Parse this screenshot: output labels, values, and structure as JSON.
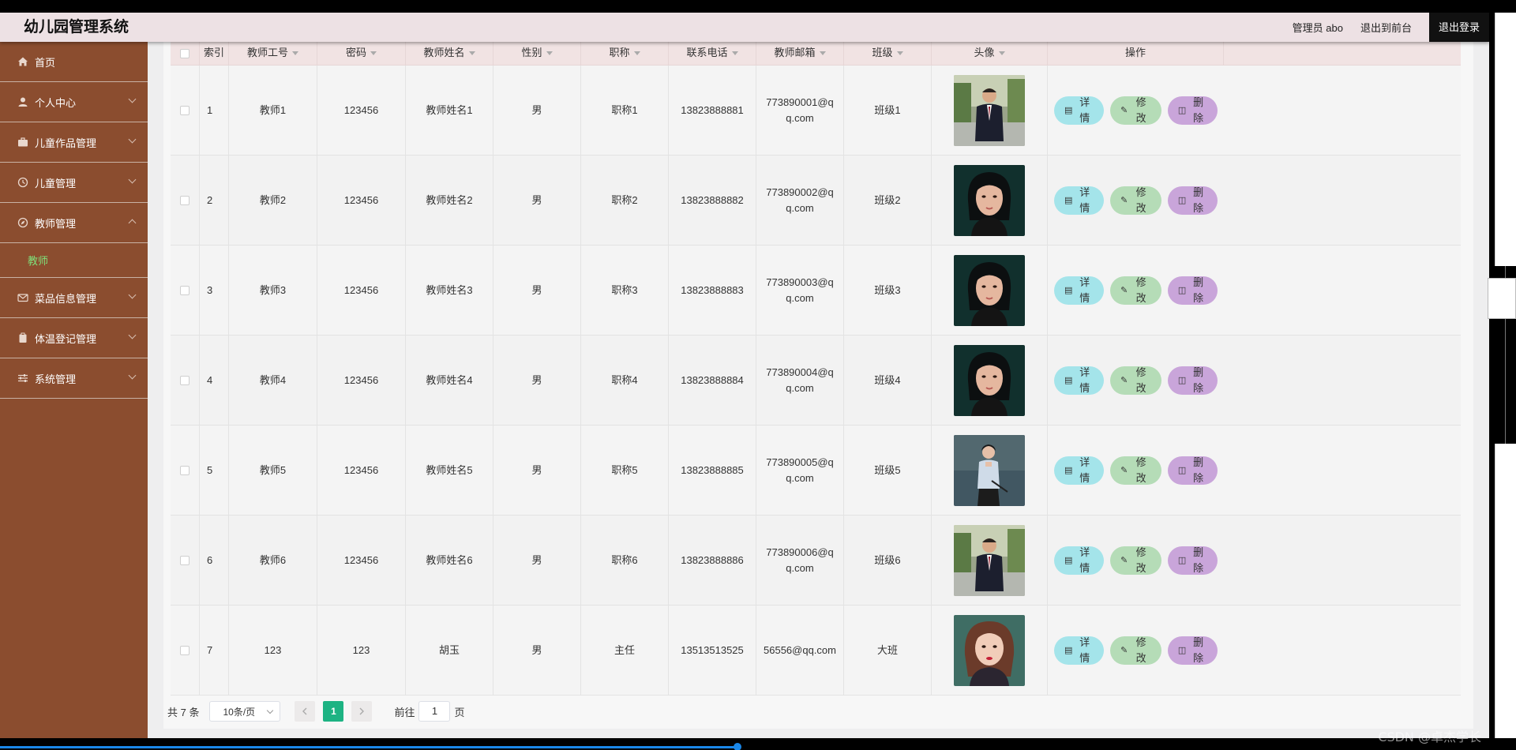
{
  "header": {
    "brand": "幼儿园管理系统",
    "user": "管理员 abo",
    "front_link": "退出到前台",
    "logout": "退出登录"
  },
  "sidebar": {
    "items": [
      {
        "label": "首页",
        "icon": "home-icon",
        "has_children": false
      },
      {
        "label": "个人中心",
        "icon": "user-icon",
        "has_children": true
      },
      {
        "label": "儿童作品管理",
        "icon": "briefcase-icon",
        "has_children": true
      },
      {
        "label": "儿童管理",
        "icon": "clock-icon",
        "has_children": true
      },
      {
        "label": "教师管理",
        "icon": "compass-icon",
        "has_children": true,
        "open": true,
        "children": [
          "教师"
        ]
      },
      {
        "label": "菜品信息管理",
        "icon": "mail-icon",
        "has_children": true
      },
      {
        "label": "体温登记管理",
        "icon": "clipboard-icon",
        "has_children": true
      },
      {
        "label": "系统管理",
        "icon": "sliders-icon",
        "has_children": true
      }
    ]
  },
  "table": {
    "columns": [
      "",
      "索引",
      "教师工号",
      "密码",
      "教师姓名",
      "性别",
      "职称",
      "联系电话",
      "教师邮箱",
      "班级",
      "头像",
      "操作"
    ],
    "rows": [
      {
        "index": "1",
        "id": "教师1",
        "password": "123456",
        "name": "教师姓名1",
        "gender": "男",
        "title": "职称1",
        "phone": "13823888881",
        "email": "773890001@qq.com",
        "class": "班级1",
        "avatar": "man-suit"
      },
      {
        "index": "2",
        "id": "教师2",
        "password": "123456",
        "name": "教师姓名2",
        "gender": "男",
        "title": "职称2",
        "phone": "13823888882",
        "email": "773890002@qq.com",
        "class": "班级2",
        "avatar": "woman-dark"
      },
      {
        "index": "3",
        "id": "教师3",
        "password": "123456",
        "name": "教师姓名3",
        "gender": "男",
        "title": "职称3",
        "phone": "13823888883",
        "email": "773890003@qq.com",
        "class": "班级3",
        "avatar": "woman-dark"
      },
      {
        "index": "4",
        "id": "教师4",
        "password": "123456",
        "name": "教师姓名4",
        "gender": "男",
        "title": "职称4",
        "phone": "13823888884",
        "email": "773890004@qq.com",
        "class": "班级4",
        "avatar": "woman-dark"
      },
      {
        "index": "5",
        "id": "教师5",
        "password": "123456",
        "name": "教师姓名5",
        "gender": "男",
        "title": "职称5",
        "phone": "13823888885",
        "email": "773890005@qq.com",
        "class": "班级5",
        "avatar": "woman-shirt"
      },
      {
        "index": "6",
        "id": "教师6",
        "password": "123456",
        "name": "教师姓名6",
        "gender": "男",
        "title": "职称6",
        "phone": "13823888886",
        "email": "773890006@qq.com",
        "class": "班级6",
        "avatar": "man-suit"
      },
      {
        "index": "7",
        "id": "123",
        "password": "123",
        "name": "胡玉",
        "gender": "男",
        "title": "主任",
        "phone": "13513513525",
        "email": "56556@qq.com",
        "class": "大班",
        "avatar": "woman-red"
      }
    ],
    "ops": {
      "detail": "详情",
      "edit": "修改",
      "delete": "删除"
    }
  },
  "pager": {
    "total": "共 7 条",
    "page_size": "10条/页",
    "current": "1",
    "goto_prefix": "前往",
    "goto_value": "1",
    "goto_suffix": "页"
  },
  "watermark": "CSDN @卓杰学长",
  "colors": {
    "sidebar": "#8b4d2f",
    "header": "#ede1e4",
    "detail": "#a4e4ea",
    "edit": "#b5dcb7",
    "delete": "#c9a5da",
    "pager_current": "#1db383"
  }
}
